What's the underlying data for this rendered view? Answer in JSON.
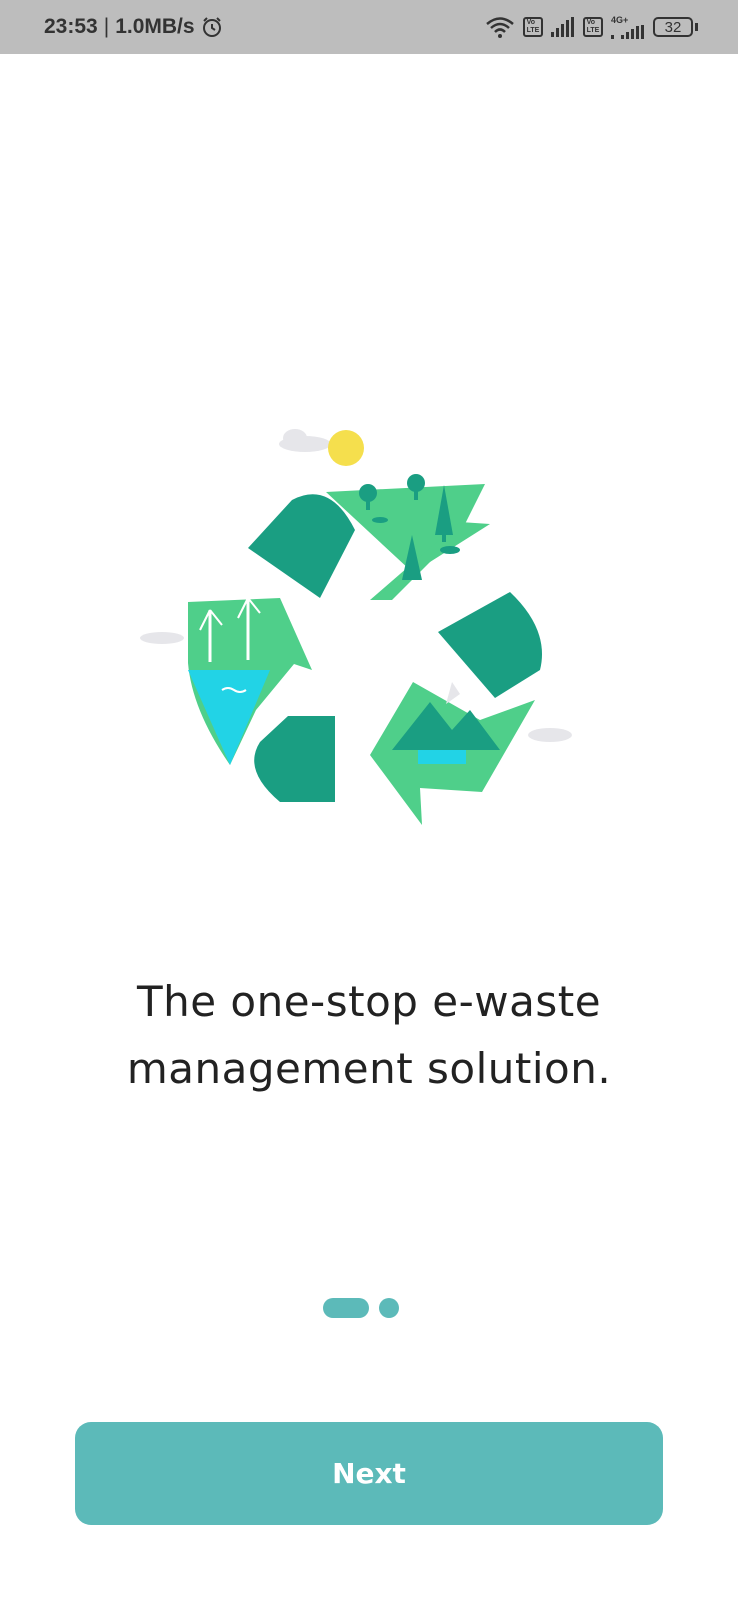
{
  "status_bar": {
    "time": "23:53",
    "network_speed": "1.0MB/s",
    "alarm_icon": "alarm-clock-icon",
    "wifi_icon": "wifi-icon",
    "volte_label": "Vo\nLTE",
    "sim2_network": "4G+",
    "battery_level": "32"
  },
  "onboarding": {
    "illustration_icon": "recycling-nature-illustration",
    "headline": "The one-stop e-waste management solution.",
    "page_count": 2,
    "current_page": 1
  },
  "actions": {
    "next_label": "Next"
  },
  "colors": {
    "accent": "#5cbab9",
    "dark_green": "#1a9e82",
    "light_green": "#4fcf8a",
    "water": "#22d3e6",
    "sun": "#f5df4d"
  }
}
